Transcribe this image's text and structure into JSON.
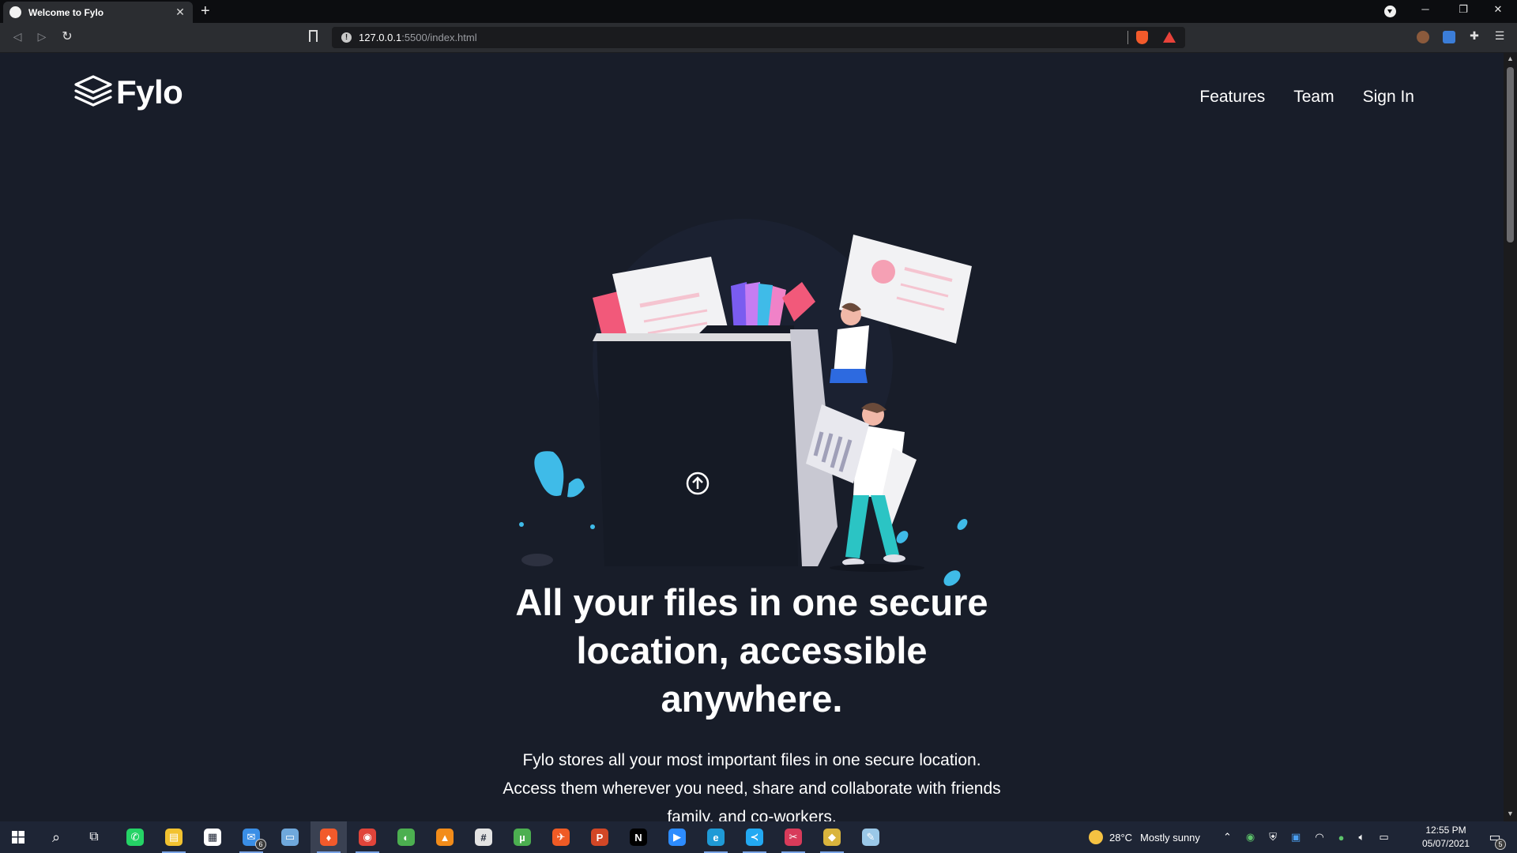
{
  "browser": {
    "tab_title": "Welcome to Fylo",
    "tab_close": "✕",
    "new_tab": "+",
    "url_host": "127.0.0.1",
    "url_rest": ":5500/index.html",
    "window_controls": {
      "minimize": "─",
      "restore": "❐",
      "close": "✕"
    }
  },
  "site": {
    "logo_text": "Fylo",
    "nav": [
      {
        "label": "Features"
      },
      {
        "label": "Team"
      },
      {
        "label": "Sign In"
      }
    ],
    "headline_lines": [
      "All your files in one secure",
      "location, accessible",
      "anywhere."
    ],
    "subtext_lines": [
      "Fylo stores all your most important files in one secure location.",
      "Access them wherever you need, share and collaborate with friends",
      "family, and co-workers."
    ]
  },
  "taskbar": {
    "weather_temp": "28°C",
    "weather_desc": "Mostly sunny",
    "time": "12:55 PM",
    "date": "05/07/2021",
    "mail_badge": "6",
    "notif_badge": "5",
    "apps": [
      {
        "name": "whatsapp",
        "color": "#25d366",
        "glyph": "✆"
      },
      {
        "name": "file-explorer",
        "color": "#f2c230",
        "glyph": "▤"
      },
      {
        "name": "store",
        "color": "#ffffff",
        "glyph": "▦"
      },
      {
        "name": "mail",
        "color": "#3a8ee6",
        "glyph": "✉"
      },
      {
        "name": "laptop",
        "color": "#6fa8dc",
        "glyph": "▭"
      },
      {
        "name": "brave",
        "color": "#f25a2b",
        "glyph": "♦"
      },
      {
        "name": "chrome",
        "color": "#e0443a",
        "glyph": "◉"
      },
      {
        "name": "chrome-canary",
        "color": "#4caf50",
        "glyph": "◐"
      },
      {
        "name": "vlc",
        "color": "#f28c1a",
        "glyph": "▲"
      },
      {
        "name": "slack",
        "color": "#e3e3e3",
        "glyph": "#"
      },
      {
        "name": "utorrent",
        "color": "#4caf50",
        "glyph": "µ"
      },
      {
        "name": "postman",
        "color": "#ef5b25",
        "glyph": "✈"
      },
      {
        "name": "powerpoint-app",
        "color": "#d24726",
        "glyph": "P"
      },
      {
        "name": "netflix",
        "color": "#000000",
        "glyph": "N"
      },
      {
        "name": "zoom",
        "color": "#2d8cff",
        "glyph": "▶"
      },
      {
        "name": "edge",
        "color": "#1f9ad6",
        "glyph": "e"
      },
      {
        "name": "vscode",
        "color": "#23a9f2",
        "glyph": "≺"
      },
      {
        "name": "snipping-tool",
        "color": "#d83b5a",
        "glyph": "✂"
      },
      {
        "name": "git",
        "color": "#d9b43d",
        "glyph": "◆"
      },
      {
        "name": "notepad",
        "color": "#9ac8e8",
        "glyph": "✎"
      }
    ]
  }
}
